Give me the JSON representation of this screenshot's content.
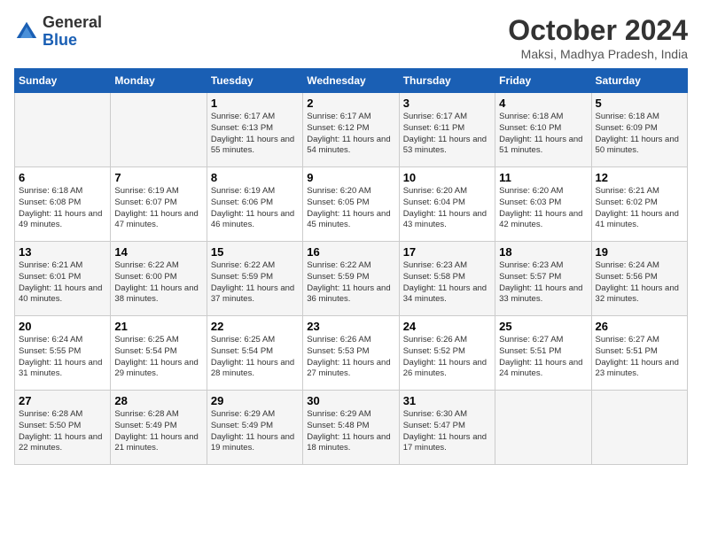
{
  "header": {
    "logo_general": "General",
    "logo_blue": "Blue",
    "month": "October 2024",
    "location": "Maksi, Madhya Pradesh, India"
  },
  "columns": [
    "Sunday",
    "Monday",
    "Tuesday",
    "Wednesday",
    "Thursday",
    "Friday",
    "Saturday"
  ],
  "weeks": [
    [
      {
        "day": "",
        "info": ""
      },
      {
        "day": "",
        "info": ""
      },
      {
        "day": "1",
        "info": "Sunrise: 6:17 AM\nSunset: 6:13 PM\nDaylight: 11 hours and 55 minutes."
      },
      {
        "day": "2",
        "info": "Sunrise: 6:17 AM\nSunset: 6:12 PM\nDaylight: 11 hours and 54 minutes."
      },
      {
        "day": "3",
        "info": "Sunrise: 6:17 AM\nSunset: 6:11 PM\nDaylight: 11 hours and 53 minutes."
      },
      {
        "day": "4",
        "info": "Sunrise: 6:18 AM\nSunset: 6:10 PM\nDaylight: 11 hours and 51 minutes."
      },
      {
        "day": "5",
        "info": "Sunrise: 6:18 AM\nSunset: 6:09 PM\nDaylight: 11 hours and 50 minutes."
      }
    ],
    [
      {
        "day": "6",
        "info": "Sunrise: 6:18 AM\nSunset: 6:08 PM\nDaylight: 11 hours and 49 minutes."
      },
      {
        "day": "7",
        "info": "Sunrise: 6:19 AM\nSunset: 6:07 PM\nDaylight: 11 hours and 47 minutes."
      },
      {
        "day": "8",
        "info": "Sunrise: 6:19 AM\nSunset: 6:06 PM\nDaylight: 11 hours and 46 minutes."
      },
      {
        "day": "9",
        "info": "Sunrise: 6:20 AM\nSunset: 6:05 PM\nDaylight: 11 hours and 45 minutes."
      },
      {
        "day": "10",
        "info": "Sunrise: 6:20 AM\nSunset: 6:04 PM\nDaylight: 11 hours and 43 minutes."
      },
      {
        "day": "11",
        "info": "Sunrise: 6:20 AM\nSunset: 6:03 PM\nDaylight: 11 hours and 42 minutes."
      },
      {
        "day": "12",
        "info": "Sunrise: 6:21 AM\nSunset: 6:02 PM\nDaylight: 11 hours and 41 minutes."
      }
    ],
    [
      {
        "day": "13",
        "info": "Sunrise: 6:21 AM\nSunset: 6:01 PM\nDaylight: 11 hours and 40 minutes."
      },
      {
        "day": "14",
        "info": "Sunrise: 6:22 AM\nSunset: 6:00 PM\nDaylight: 11 hours and 38 minutes."
      },
      {
        "day": "15",
        "info": "Sunrise: 6:22 AM\nSunset: 5:59 PM\nDaylight: 11 hours and 37 minutes."
      },
      {
        "day": "16",
        "info": "Sunrise: 6:22 AM\nSunset: 5:59 PM\nDaylight: 11 hours and 36 minutes."
      },
      {
        "day": "17",
        "info": "Sunrise: 6:23 AM\nSunset: 5:58 PM\nDaylight: 11 hours and 34 minutes."
      },
      {
        "day": "18",
        "info": "Sunrise: 6:23 AM\nSunset: 5:57 PM\nDaylight: 11 hours and 33 minutes."
      },
      {
        "day": "19",
        "info": "Sunrise: 6:24 AM\nSunset: 5:56 PM\nDaylight: 11 hours and 32 minutes."
      }
    ],
    [
      {
        "day": "20",
        "info": "Sunrise: 6:24 AM\nSunset: 5:55 PM\nDaylight: 11 hours and 31 minutes."
      },
      {
        "day": "21",
        "info": "Sunrise: 6:25 AM\nSunset: 5:54 PM\nDaylight: 11 hours and 29 minutes."
      },
      {
        "day": "22",
        "info": "Sunrise: 6:25 AM\nSunset: 5:54 PM\nDaylight: 11 hours and 28 minutes."
      },
      {
        "day": "23",
        "info": "Sunrise: 6:26 AM\nSunset: 5:53 PM\nDaylight: 11 hours and 27 minutes."
      },
      {
        "day": "24",
        "info": "Sunrise: 6:26 AM\nSunset: 5:52 PM\nDaylight: 11 hours and 26 minutes."
      },
      {
        "day": "25",
        "info": "Sunrise: 6:27 AM\nSunset: 5:51 PM\nDaylight: 11 hours and 24 minutes."
      },
      {
        "day": "26",
        "info": "Sunrise: 6:27 AM\nSunset: 5:51 PM\nDaylight: 11 hours and 23 minutes."
      }
    ],
    [
      {
        "day": "27",
        "info": "Sunrise: 6:28 AM\nSunset: 5:50 PM\nDaylight: 11 hours and 22 minutes."
      },
      {
        "day": "28",
        "info": "Sunrise: 6:28 AM\nSunset: 5:49 PM\nDaylight: 11 hours and 21 minutes."
      },
      {
        "day": "29",
        "info": "Sunrise: 6:29 AM\nSunset: 5:49 PM\nDaylight: 11 hours and 19 minutes."
      },
      {
        "day": "30",
        "info": "Sunrise: 6:29 AM\nSunset: 5:48 PM\nDaylight: 11 hours and 18 minutes."
      },
      {
        "day": "31",
        "info": "Sunrise: 6:30 AM\nSunset: 5:47 PM\nDaylight: 11 hours and 17 minutes."
      },
      {
        "day": "",
        "info": ""
      },
      {
        "day": "",
        "info": ""
      }
    ]
  ]
}
